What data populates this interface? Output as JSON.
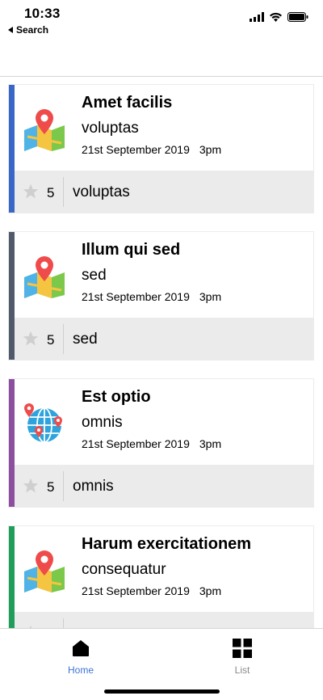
{
  "status_bar": {
    "time": "10:33",
    "back_label": "Search"
  },
  "cards": [
    {
      "title": "Amet facilis",
      "subtitle": "voluptas",
      "date": "21st September 2019",
      "time": "3pm",
      "rating": "5",
      "footer_text": "voluptas",
      "accent_color": "#3867c7",
      "icon": "map-pin-icon"
    },
    {
      "title": "Illum qui sed",
      "subtitle": "sed",
      "date": "21st September 2019",
      "time": "3pm",
      "rating": "5",
      "footer_text": "sed",
      "accent_color": "#505a6b",
      "icon": "map-pin-icon"
    },
    {
      "title": "Est optio",
      "subtitle": "omnis",
      "date": "21st September 2019",
      "time": "3pm",
      "rating": "5",
      "footer_text": "omnis",
      "accent_color": "#8c4fa0",
      "icon": "globe-pin-icon"
    },
    {
      "title": "Harum exercitationem",
      "subtitle": "consequatur",
      "date": "21st September 2019",
      "time": "3pm",
      "rating": "",
      "footer_text": "",
      "accent_color": "#1f9e59",
      "icon": "map-pin-icon"
    }
  ],
  "tab_bar": {
    "home_label": "Home",
    "list_label": "List",
    "active_color": "#3b73d6",
    "inactive_color": "#8a8a8a"
  }
}
